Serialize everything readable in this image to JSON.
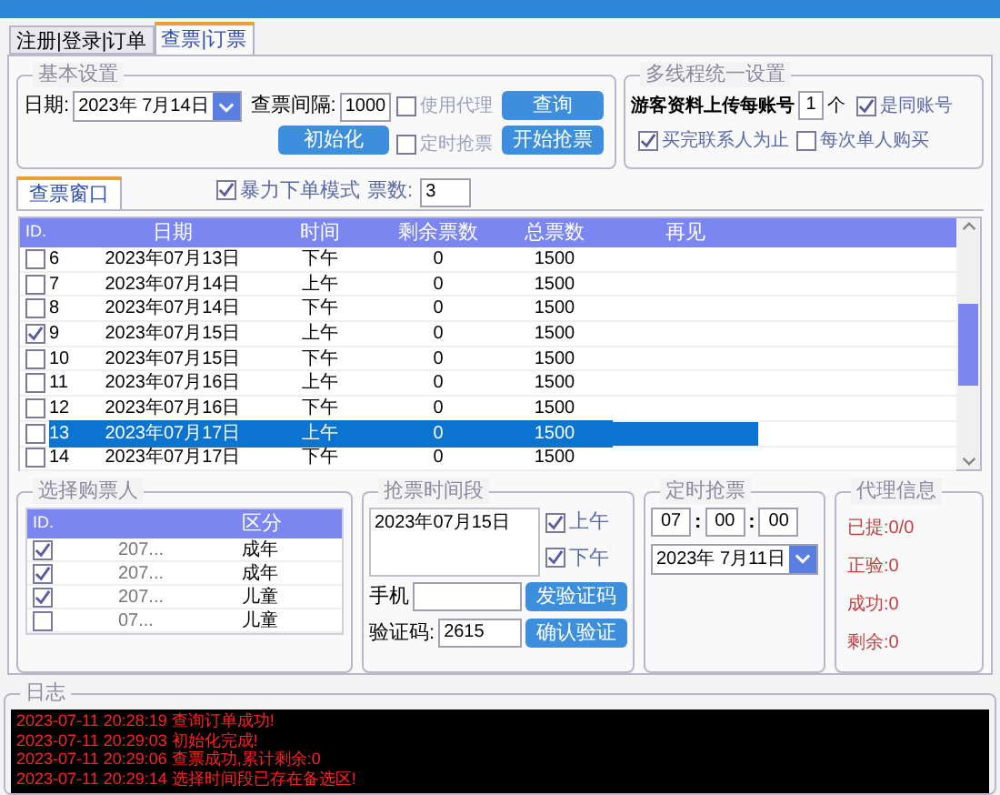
{
  "tabs": [
    {
      "label": "注册|登录|订单",
      "selected": false
    },
    {
      "label": "查票|订票",
      "selected": true
    }
  ],
  "basic": {
    "title": "基本设置",
    "date_label": "日期:",
    "date_value": "2023年 7月14日",
    "interval_label": "查票间隔:",
    "interval_value": "1000",
    "init_button": "初始化",
    "options": [
      {
        "label": "使用代理",
        "checked": false
      },
      {
        "label": "定时抢票",
        "checked": false
      }
    ],
    "buttons": [
      "查询",
      "开始抢票"
    ]
  },
  "multi": {
    "title": "多线程统一设置",
    "upload_label": "游客资料上传每账号",
    "upload_value": "1",
    "unit": "个",
    "options": [
      {
        "label": "是同账号",
        "checked": true
      },
      {
        "label": "买完联系人为止",
        "checked": true
      },
      {
        "label": "每次单人购买",
        "checked": false
      }
    ]
  },
  "query_tab": {
    "label": "查票窗口",
    "selected": true
  },
  "force": {
    "label": "暴力下单模式",
    "checked": true
  },
  "count_label": "票数:",
  "count_value": "3",
  "table": {
    "columns": [
      "ID.",
      "日期",
      "时间",
      "剩余票数",
      "总票数",
      "再见"
    ],
    "rows": [
      {
        "checked": false,
        "selected": false,
        "cells": [
          "6",
          "2023年07月13日",
          "下午",
          "0",
          "1500"
        ]
      },
      {
        "checked": false,
        "selected": false,
        "cells": [
          "7",
          "2023年07月14日",
          "上午",
          "0",
          "1500"
        ]
      },
      {
        "checked": false,
        "selected": false,
        "cells": [
          "8",
          "2023年07月14日",
          "下午",
          "0",
          "1500"
        ]
      },
      {
        "checked": true,
        "selected": false,
        "cells": [
          "9",
          "2023年07月15日",
          "上午",
          "0",
          "1500"
        ]
      },
      {
        "checked": false,
        "selected": false,
        "cells": [
          "10",
          "2023年07月15日",
          "下午",
          "0",
          "1500"
        ]
      },
      {
        "checked": false,
        "selected": false,
        "cells": [
          "11",
          "2023年07月16日",
          "上午",
          "0",
          "1500"
        ]
      },
      {
        "checked": false,
        "selected": false,
        "cells": [
          "12",
          "2023年07月16日",
          "下午",
          "0",
          "1500"
        ]
      },
      {
        "checked": false,
        "selected": true,
        "cells": [
          "13",
          "2023年07月17日",
          "上午",
          "0",
          "1500"
        ]
      },
      {
        "checked": false,
        "selected": false,
        "cells": [
          "14",
          "2023年07月17日",
          "下午",
          "0",
          "1500"
        ]
      }
    ]
  },
  "passengers": {
    "title": "选择购票人",
    "columns": [
      "ID.",
      "区分"
    ],
    "rows": [
      {
        "checked": true,
        "id": "207...",
        "type": "成年"
      },
      {
        "checked": true,
        "id": "207...",
        "type": "成年"
      },
      {
        "checked": true,
        "id": "207...",
        "type": "儿童"
      },
      {
        "checked": false,
        "id": "07...",
        "type": "儿童"
      }
    ]
  },
  "period": {
    "title": "抢票时间段",
    "list": [
      "2023年07月15日"
    ],
    "options": [
      {
        "label": "上午",
        "checked": true
      },
      {
        "label": "下午",
        "checked": true
      }
    ],
    "phone_label": "手机",
    "send_button": "发验证码",
    "code_label": "验证码:",
    "code_value": "2615",
    "confirm_button": "确认验证"
  },
  "timer": {
    "title": "定时抢票",
    "hour": "07",
    "minute": "00",
    "second": "00",
    "sep": ":",
    "date_value": "2023年 7月11日"
  },
  "proxy": {
    "title": "代理信息",
    "items": [
      "已提:0/0",
      "正验:0",
      "成功:0",
      "剩余:0"
    ]
  },
  "log": {
    "title": "日志",
    "lines": [
      "2023-07-11 20:28:19 查询订单成功!",
      "2023-07-11 20:29:03 初始化完成!",
      "2023-07-11 20:29:06 查票成功,累计剩余:0",
      "2023-07-11 20:29:14 选择时间段已存在备选区!"
    ]
  }
}
